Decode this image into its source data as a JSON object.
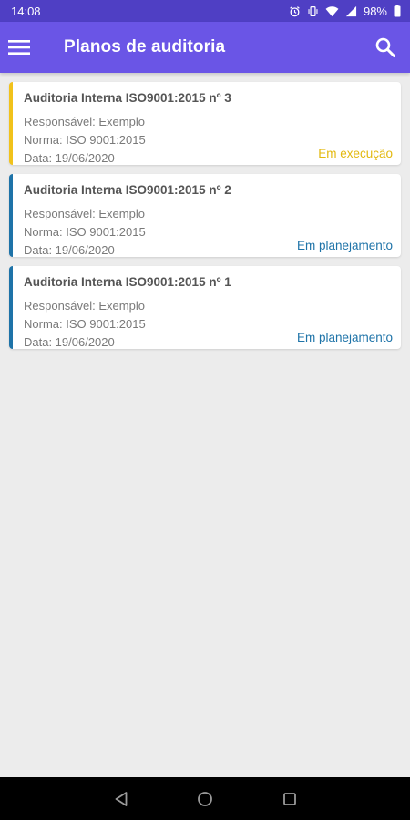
{
  "status_bar": {
    "time": "14:08",
    "battery": "98%",
    "icons": [
      "alarm-icon",
      "vibrate-icon",
      "wifi-icon",
      "signal-icon",
      "battery-icon"
    ]
  },
  "app_bar": {
    "title": "Planos de auditoria",
    "menu_icon": "hamburger-menu-icon",
    "search_icon": "search-icon"
  },
  "colors": {
    "status_bar": "#4f3fc4",
    "app_bar": "#6a55e6",
    "background": "#ececec",
    "in_execution": "#e3b90f",
    "in_planning": "#1e73a8"
  },
  "audits": [
    {
      "title": "Auditoria Interna ISO9001:2015 nº 3",
      "responsavel": "Responsável: Exemplo",
      "norma": "Norma: ISO 9001:2015",
      "data": "Data: 19/06/2020",
      "status": "Em execução"
    },
    {
      "title": "Auditoria Interna ISO9001:2015 nº 2",
      "responsavel": "Responsável: Exemplo",
      "norma": "Norma: ISO 9001:2015",
      "data": "Data: 19/06/2020",
      "status": "Em planejamento"
    },
    {
      "title": "Auditoria Interna ISO9001:2015 nº 1",
      "responsavel": "Responsável: Exemplo",
      "norma": "Norma: ISO 9001:2015",
      "data": "Data: 19/06/2020",
      "status": "Em planejamento"
    }
  ],
  "nav_bar": [
    "back-icon",
    "home-icon",
    "recents-icon"
  ]
}
